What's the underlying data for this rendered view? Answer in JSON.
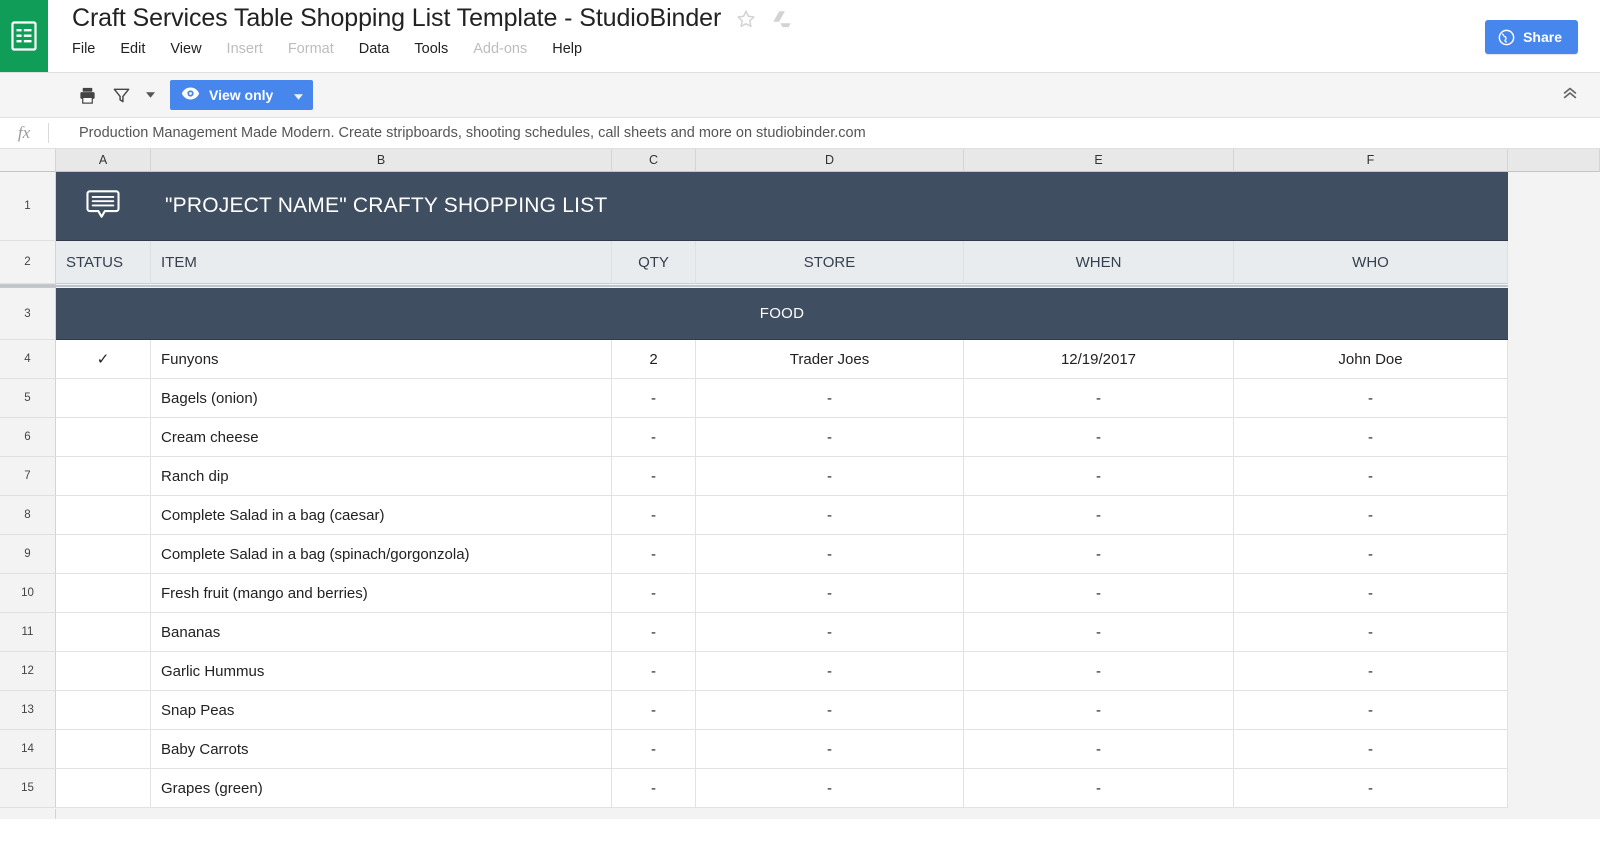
{
  "app": {
    "logo_icon": "sheets-logo-icon",
    "accent_green": "#0F9D58",
    "accent_blue": "#4787ED",
    "header_dark": "#404E61",
    "header_light": "#E8ECEF"
  },
  "titlebar": {
    "doc_title": "Craft Services Table Shopping List Template - StudioBinder",
    "star_icon": "star-icon",
    "drive_icon": "move-to-drive-icon",
    "share_label": "Share",
    "share_icon": "globe-icon"
  },
  "menubar": {
    "items": [
      {
        "label": "File",
        "disabled": false
      },
      {
        "label": "Edit",
        "disabled": false
      },
      {
        "label": "View",
        "disabled": false
      },
      {
        "label": "Insert",
        "disabled": true
      },
      {
        "label": "Format",
        "disabled": true
      },
      {
        "label": "Data",
        "disabled": false
      },
      {
        "label": "Tools",
        "disabled": false
      },
      {
        "label": "Add-ons",
        "disabled": true
      },
      {
        "label": "Help",
        "disabled": false
      }
    ]
  },
  "toolbar": {
    "print_icon": "print-icon",
    "filter_icon": "filter-icon",
    "filter_caret_icon": "chevron-down-icon",
    "view_only_label": "View only",
    "view_only_icon": "eye-icon",
    "view_only_caret_icon": "chevron-down-icon",
    "collapse_icon": "double-chevron-up-icon"
  },
  "formula_bar": {
    "fx_label": "fx",
    "value": "Production Management Made Modern. Create stripboards, shooting schedules, call sheets and more on studiobinder.com"
  },
  "sheet": {
    "column_headers": [
      "A",
      "B",
      "C",
      "D",
      "E",
      "F"
    ],
    "row_numbers": [
      "1",
      "2",
      "3",
      "4",
      "5",
      "6",
      "7",
      "8",
      "9",
      "10",
      "11",
      "12",
      "13",
      "14",
      "15"
    ],
    "title_row": {
      "row_number": "1",
      "icon": "speech-bubble-icon",
      "text": "\"PROJECT NAME\" CRAFTY SHOPPING LIST"
    },
    "header_row": {
      "row_number": "2",
      "cells": [
        "STATUS",
        "ITEM",
        "QTY",
        "STORE",
        "WHEN",
        "WHO"
      ]
    },
    "section_row": {
      "row_number": "3",
      "label": "FOOD"
    },
    "data_rows": [
      {
        "row_number": "4",
        "status": "✓",
        "item": "Funyons",
        "qty": "2",
        "store": "Trader Joes",
        "when": "12/19/2017",
        "who": "John Doe"
      },
      {
        "row_number": "5",
        "status": "",
        "item": "Bagels (onion)",
        "qty": "-",
        "store": "-",
        "when": "-",
        "who": "-"
      },
      {
        "row_number": "6",
        "status": "",
        "item": "Cream cheese",
        "qty": "-",
        "store": "-",
        "when": "-",
        "who": "-"
      },
      {
        "row_number": "7",
        "status": "",
        "item": "Ranch dip",
        "qty": "-",
        "store": "-",
        "when": "-",
        "who": "-"
      },
      {
        "row_number": "8",
        "status": "",
        "item": "Complete Salad in a bag (caesar)",
        "qty": "-",
        "store": "-",
        "when": "-",
        "who": "-"
      },
      {
        "row_number": "9",
        "status": "",
        "item": "Complete Salad in a bag (spinach/gorgonzola)",
        "qty": "-",
        "store": "-",
        "when": "-",
        "who": "-"
      },
      {
        "row_number": "10",
        "status": "",
        "item": "Fresh fruit (mango and berries)",
        "qty": "-",
        "store": "-",
        "when": "-",
        "who": "-"
      },
      {
        "row_number": "11",
        "status": "",
        "item": "Bananas",
        "qty": "-",
        "store": "-",
        "when": "-",
        "who": "-"
      },
      {
        "row_number": "12",
        "status": "",
        "item": "Garlic Hummus",
        "qty": "-",
        "store": "-",
        "when": "-",
        "who": "-"
      },
      {
        "row_number": "13",
        "status": "",
        "item": "Snap Peas",
        "qty": "-",
        "store": "-",
        "when": "-",
        "who": "-"
      },
      {
        "row_number": "14",
        "status": "",
        "item": "Baby Carrots",
        "qty": "-",
        "store": "-",
        "when": "-",
        "who": "-"
      },
      {
        "row_number": "15",
        "status": "",
        "item": "Grapes (green)",
        "qty": "-",
        "store": "-",
        "when": "-",
        "who": "-"
      }
    ]
  }
}
